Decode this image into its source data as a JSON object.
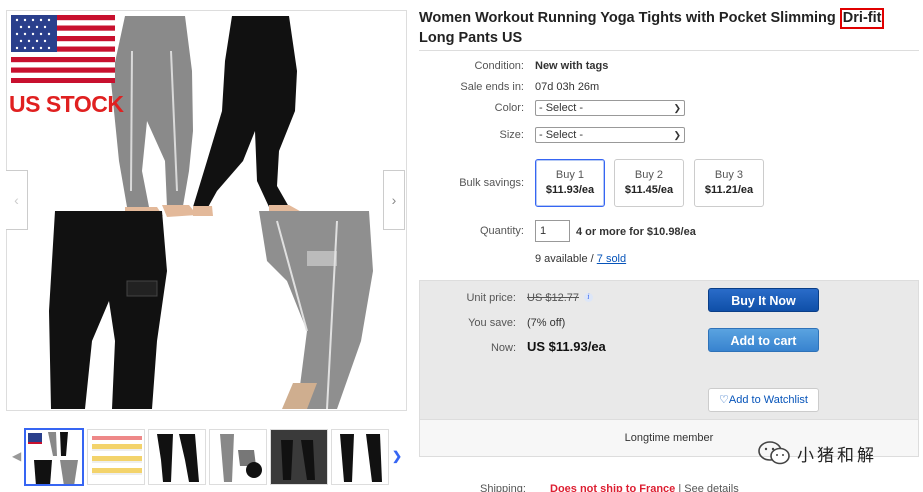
{
  "gallery": {
    "flag_label": "US STOCK",
    "prev_icon": "chevron-left-icon",
    "next_icon": "chevron-right-icon"
  },
  "listing": {
    "title_part1": "Women Workout Running Yoga Tights with Pocket Slimming ",
    "title_highlight": "Dri-fit",
    "title_part2": " Long Pants US"
  },
  "details": {
    "condition_label": "Condition:",
    "condition_value": "New with tags",
    "ends_label": "Sale ends in:",
    "ends_value": "07d 03h 26m",
    "color_label": "Color:",
    "color_select": "- Select -",
    "size_label": "Size:",
    "size_select": "- Select -",
    "bulk_label": "Bulk savings:",
    "bulk_options": [
      {
        "title": "Buy 1",
        "price": "$11.93/ea"
      },
      {
        "title": "Buy 2",
        "price": "$11.45/ea"
      },
      {
        "title": "Buy 3",
        "price": "$11.21/ea"
      }
    ],
    "quantity_label": "Quantity:",
    "quantity_value": "1",
    "quantity_offer": "4 or more for $10.98/ea",
    "available": "9 available / ",
    "sold": "7 sold"
  },
  "buybox": {
    "unit_price_label": "Unit price:",
    "unit_price_value": "US $12.77",
    "save_label": "You save:",
    "save_value": "(7% off)",
    "now_label": "Now:",
    "now_value": "US $11.93/ea",
    "buy_now": "Buy It Now",
    "add_to_cart": "Add to cart",
    "watchlist": "Add to Watchlist",
    "member": "Longtime member"
  },
  "shipping": {
    "label": "Shipping:",
    "value": "Does not ship to France",
    "details": " | See details"
  },
  "watermark": {
    "text": "小猪和解"
  },
  "colors": {
    "highlight_border": "#e00000",
    "buy_now": "#0f4fa8",
    "add_to_cart": "#3883cf",
    "link": "#0654ba"
  }
}
